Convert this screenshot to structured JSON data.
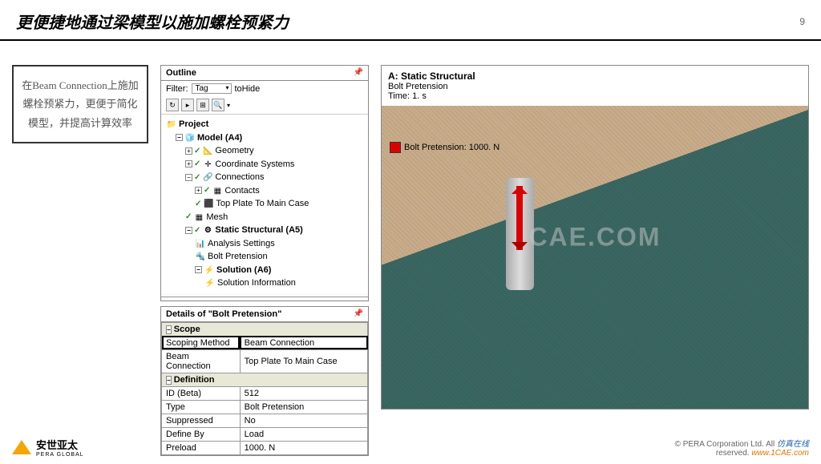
{
  "header": {
    "title": "更便捷地通过梁模型以施加螺栓预紧力",
    "page_number": "9"
  },
  "leftbox": {
    "text": "在Beam Connection上施加螺栓预紧力，更便于简化模型，并提高计算效率"
  },
  "outline": {
    "title": "Outline",
    "filter_label": "Filter:",
    "filter_value": "Tag",
    "filter_text": "toHide",
    "tree": {
      "root": "Project",
      "model": "Model (A4)",
      "geometry": "Geometry",
      "coord": "Coordinate Systems",
      "conn": "Connections",
      "contacts": "Contacts",
      "topplate": "Top Plate To Main Case",
      "mesh": "Mesh",
      "staticstruct": "Static Structural (A5)",
      "analysis": "Analysis Settings",
      "boltpre": "Bolt Pretension",
      "solution": "Solution (A6)",
      "solinfo": "Solution Information"
    }
  },
  "details": {
    "title": "Details of \"Bolt Pretension\"",
    "sections": {
      "scope": "Scope",
      "definition": "Definition"
    },
    "rows": {
      "scoping_method": {
        "label": "Scoping Method",
        "value": "Beam Connection"
      },
      "beam_conn": {
        "label": "Beam Connection",
        "value": "Top Plate To Main Case"
      },
      "id": {
        "label": "ID (Beta)",
        "value": "512"
      },
      "type": {
        "label": "Type",
        "value": "Bolt Pretension"
      },
      "suppressed": {
        "label": "Suppressed",
        "value": "No"
      },
      "define_by": {
        "label": "Define By",
        "value": "Load"
      },
      "preload": {
        "label": "Preload",
        "value": "1000. N"
      }
    }
  },
  "viewer": {
    "title": "A: Static Structural",
    "line1": "Bolt Pretension",
    "line2": "Time: 1. s",
    "legend": "Bolt Pretension: 1000. N",
    "watermark": "CAE.COM"
  },
  "footer": {
    "brand_cn": "安世亚太",
    "brand_en": "PERA GLOBAL",
    "copyright1": "© PERA Corporation Ltd. All",
    "copyright2": "reserved.",
    "sim_text": "仿真在线",
    "url": "www.1CAE.com"
  }
}
